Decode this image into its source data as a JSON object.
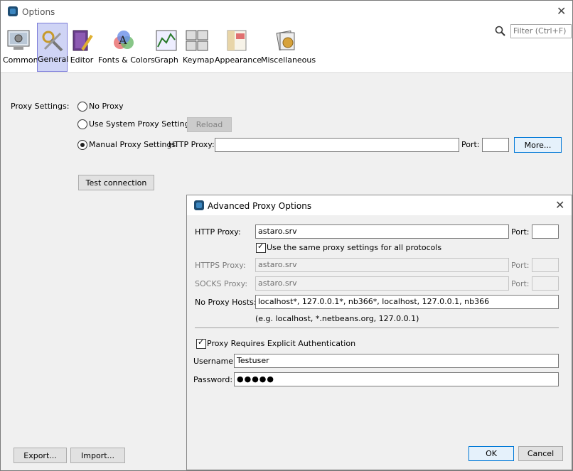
{
  "window": {
    "title": "Options"
  },
  "toolbar": {
    "items": [
      {
        "label": "Common",
        "icon": "gear-computer-icon"
      },
      {
        "label": "General",
        "icon": "tools-icon",
        "selected": true
      },
      {
        "label": "Editor",
        "icon": "editor-book-icon"
      },
      {
        "label": "Fonts & Colors",
        "icon": "fonts-colors-icon"
      },
      {
        "label": "Graph",
        "icon": "graph-icon"
      },
      {
        "label": "Keymap",
        "icon": "keymap-icon"
      },
      {
        "label": "Appearance",
        "icon": "appearance-icon"
      },
      {
        "label": "Miscellaneous",
        "icon": "miscellaneous-icon"
      }
    ]
  },
  "filter": {
    "placeholder": "Filter (Ctrl+F)"
  },
  "proxy": {
    "section_label": "Proxy Settings:",
    "no_proxy": "No Proxy",
    "system_proxy": "Use System Proxy Settings",
    "reload": "Reload",
    "manual_proxy": "Manual Proxy Settings",
    "http_proxy_label": "HTTP Proxy:",
    "http_proxy_value": "",
    "port_label": "Port:",
    "port_value": "",
    "more": "More...",
    "selected": "manual"
  },
  "test_connection": "Test connection",
  "footer": {
    "export": "Export...",
    "import": "Import..."
  },
  "dialog": {
    "title": "Advanced Proxy Options",
    "http_proxy_label": "HTTP Proxy:",
    "http_proxy_value": "astaro.srv",
    "port_label": "Port:",
    "http_port_value": "",
    "same_settings": "Use the same proxy settings for all protocols",
    "same_settings_checked": true,
    "https_proxy_label": "HTTPS Proxy:",
    "https_proxy_value": "astaro.srv",
    "socks_proxy_label": "SOCKS Proxy:",
    "socks_proxy_value": "astaro.srv",
    "no_proxy_hosts_label": "No Proxy Hosts:",
    "no_proxy_hosts_value": "localhost*, 127.0.0.1*, nb366*, localhost, 127.0.0.1, nb366",
    "no_proxy_hint": "(e.g. localhost, *.netbeans.org, 127.0.0.1)",
    "auth": "Proxy Requires Explicit Authentication",
    "auth_checked": true,
    "username_label": "Username:",
    "username_value": "Testuser",
    "password_label": "Password:",
    "password_value": "●●●●●",
    "ok": "OK",
    "cancel": "Cancel"
  },
  "colors": {
    "selected_tab_bg": "#cfd4f5",
    "default_button_border": "#0078d7"
  }
}
